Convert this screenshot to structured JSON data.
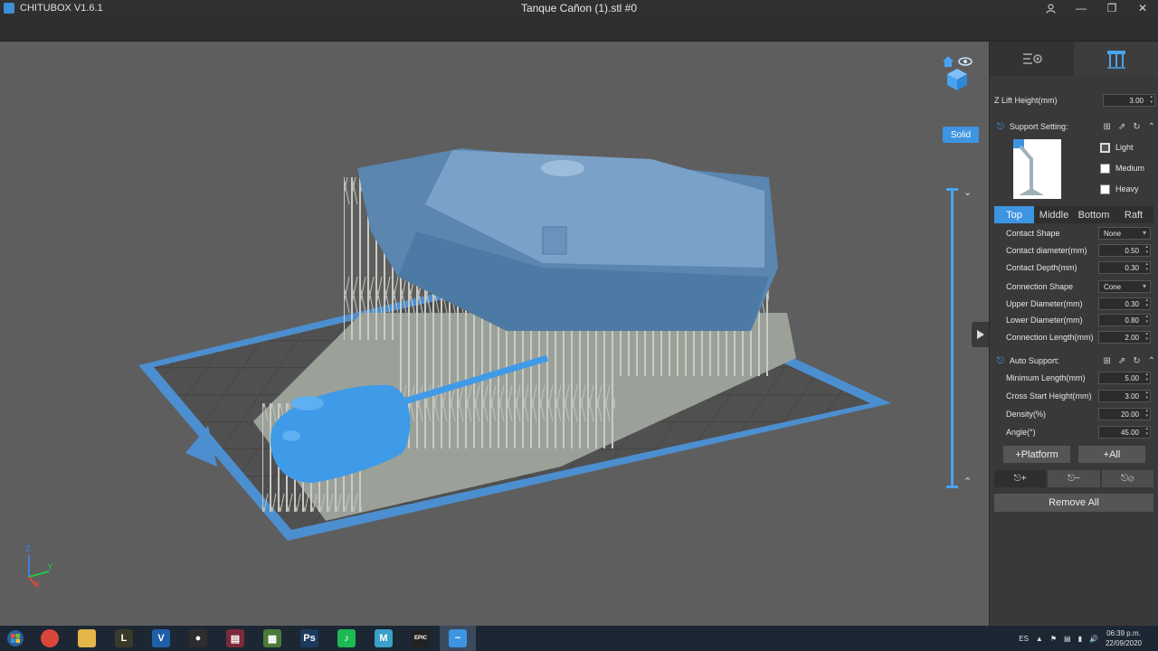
{
  "titlebar": {
    "app_name": "CHITUBOX V1.6.1",
    "window_title": "Tanque Cañon (1).stl #0",
    "user_icon": "user-icon",
    "minimize": "—",
    "restore": "❐",
    "close": "✕"
  },
  "viewport": {
    "solid_label": "Solid",
    "axis": {
      "z": "Z",
      "y": "Y",
      "x": "X"
    }
  },
  "panel": {
    "z_lift_label": "Z Lift Height(mm)",
    "z_lift_value": "3.00",
    "support_setting_label": "Support Setting:",
    "density_options": [
      {
        "label": "Light",
        "checked": true
      },
      {
        "label": "Medium",
        "checked": false
      },
      {
        "label": "Heavy",
        "checked": false
      }
    ],
    "tabs": [
      "Top",
      "Middle",
      "Bottom",
      "Raft"
    ],
    "active_tab": "Top",
    "top_params": [
      {
        "label": "Contact Shape",
        "value": "None",
        "kind": "select"
      },
      {
        "label": "Contact diameter(mm)",
        "value": "0.50",
        "kind": "number"
      },
      {
        "label": "Contact Depth(mm)",
        "value": "0.30",
        "kind": "number"
      },
      {
        "label": "Connection Shape",
        "value": "Cone",
        "kind": "select"
      },
      {
        "label": "Upper Diameter(mm)",
        "value": "0.30",
        "kind": "number"
      },
      {
        "label": "Lower Diameter(mm)",
        "value": "0.80",
        "kind": "number"
      },
      {
        "label": "Connection Length(mm)",
        "value": "2.00",
        "kind": "number"
      }
    ],
    "auto_support_label": "Auto Support:",
    "auto_params": [
      {
        "label": "Minimum Length(mm)",
        "value": "5.00"
      },
      {
        "label": "Cross Start Height(mm)",
        "value": "3.00"
      },
      {
        "label": "Density(%)",
        "value": "20.00"
      },
      {
        "label": "Angle(°)",
        "value": "45.00"
      }
    ],
    "platform_btn": "+Platform",
    "all_btn": "+All",
    "remove_all_btn": "Remove All"
  },
  "taskbar": {
    "apps": [
      {
        "name": "chrome",
        "glyph": "",
        "color": "#d9473a"
      },
      {
        "name": "file-explorer",
        "glyph": "",
        "color": "#e3b54a"
      },
      {
        "name": "league-launcher",
        "glyph": "L",
        "color": "#3a3a2a"
      },
      {
        "name": "vegas",
        "glyph": "V",
        "color": "#1f5fa8"
      },
      {
        "name": "app-circle",
        "glyph": "●",
        "color": "#2d2d2d"
      },
      {
        "name": "winrar",
        "glyph": "▤",
        "color": "#7a2a3a"
      },
      {
        "name": "minecraft",
        "glyph": "▦",
        "color": "#4a7a3a"
      },
      {
        "name": "photoshop",
        "glyph": "Ps",
        "color": "#1c3a5e"
      },
      {
        "name": "spotify",
        "glyph": "♪",
        "color": "#1db954"
      },
      {
        "name": "app-m",
        "glyph": "M",
        "color": "#3aa0c8"
      },
      {
        "name": "epic-games",
        "glyph": "EPIC",
        "color": "#222"
      },
      {
        "name": "chitubox",
        "glyph": "~",
        "color": "#3d95e2"
      }
    ],
    "language": "ES",
    "time": "06:39 p.m.",
    "date": "22/09/2020"
  }
}
